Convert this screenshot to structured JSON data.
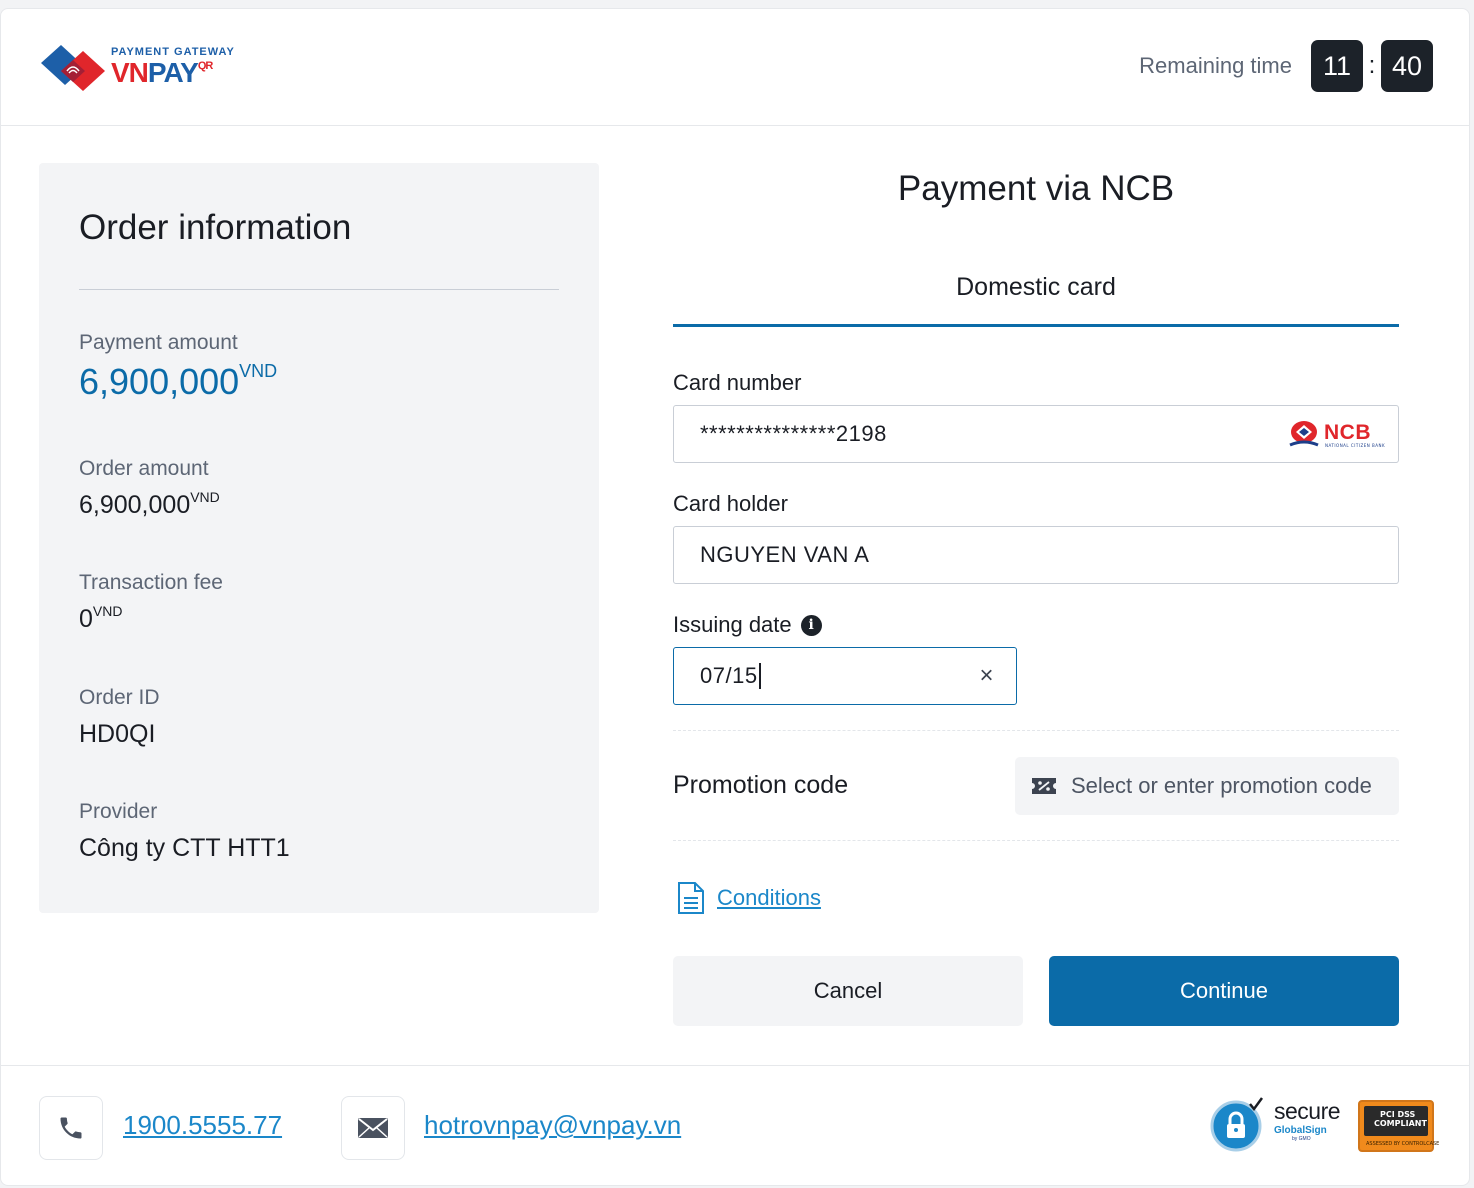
{
  "header": {
    "logo": {
      "tagline": "PAYMENT GATEWAY",
      "brand_vn": "VN",
      "brand_pay": "PAY",
      "brand_qr": "QR"
    },
    "timer": {
      "label": "Remaining time",
      "minutes": "11",
      "separator": ":",
      "seconds": "40"
    }
  },
  "order": {
    "title": "Order information",
    "payment_amount": {
      "label": "Payment amount",
      "value": "6,900,000",
      "unit": "VND"
    },
    "order_amount": {
      "label": "Order amount",
      "value": "6,900,000",
      "unit": "VND"
    },
    "transaction_fee": {
      "label": "Transaction fee",
      "value": "0",
      "unit": "VND"
    },
    "order_id": {
      "label": "Order ID",
      "value": "HD0QI"
    },
    "provider": {
      "label": "Provider",
      "value": "Công ty CTT HTT1"
    }
  },
  "payment": {
    "title": "Payment via NCB",
    "tab": "Domestic card",
    "card_number": {
      "label": "Card number",
      "value": "***************2198",
      "bank_logo": "NCB",
      "bank_sub": "NATIONAL CITIZEN BANK"
    },
    "card_holder": {
      "label": "Card holder",
      "value": "NGUYEN VAN A"
    },
    "issuing_date": {
      "label": "Issuing date",
      "value": "07/15",
      "info_icon": "i",
      "clear_icon": "×"
    },
    "promotion": {
      "label": "Promotion code",
      "button": "Select or enter promotion code"
    },
    "conditions": "Conditions",
    "cancel": "Cancel",
    "continue": "Continue"
  },
  "footer": {
    "phone": "1900.5555.77",
    "email": "hotrovnpay@vnpay.vn",
    "secure_badge": {
      "word": "secure",
      "brand": "GlobalSign",
      "by": "by GMO"
    },
    "pci_badge": {
      "line1": "PCI DSS",
      "line2": "COMPLIANT",
      "sub": "ASSESSED BY CONTROLCASE"
    }
  },
  "colors": {
    "accent": "#0b6ba8",
    "link": "#1b87c9",
    "timer_bg": "#1c2229",
    "panel_bg": "#f3f4f6",
    "brand_red": "#e0262b",
    "brand_blue": "#1d5fa8"
  }
}
